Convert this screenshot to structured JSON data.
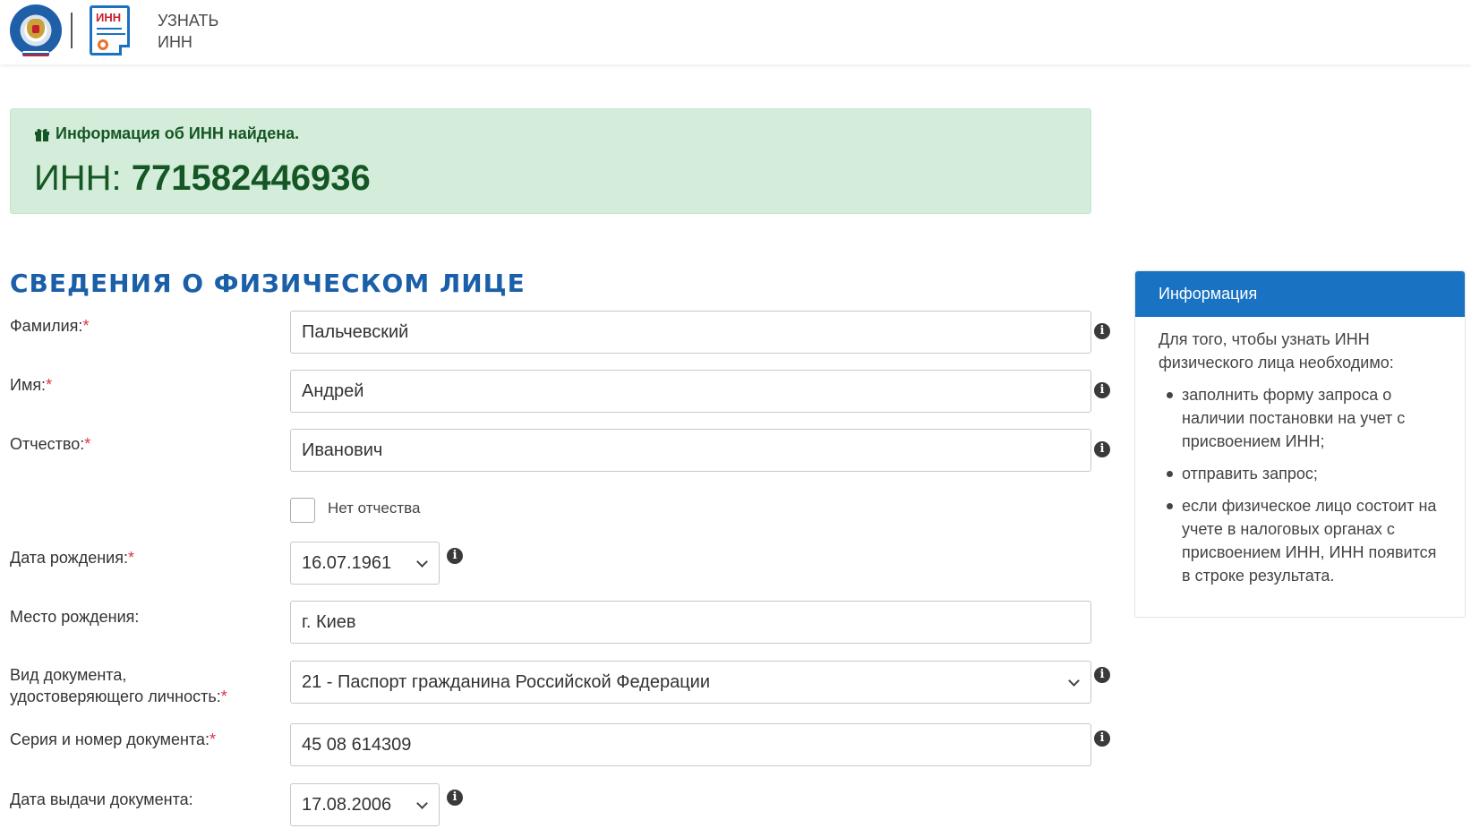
{
  "header": {
    "title_line1": "УЗНАТЬ",
    "title_line2": "ИНН",
    "doc_icon_text": "ИНН",
    "emblem_icon": "fns-emblem-icon"
  },
  "alert": {
    "message": "Информация об ИНН найдена.",
    "inn_label": "ИНН:",
    "inn_value": "771582446936",
    "color": "#d4edda"
  },
  "section": {
    "title": "СВЕДЕНИЯ О ФИЗИЧЕСКОМ ЛИЦЕ"
  },
  "form": {
    "required_mark": "*",
    "surname": {
      "label": "Фамилия:",
      "value": "Пальчевский"
    },
    "name": {
      "label": "Имя:",
      "value": "Андрей"
    },
    "patronymic": {
      "label": "Отчество:",
      "value": "Иванович"
    },
    "no_patronymic": {
      "label": "Нет отчества",
      "checked": false
    },
    "birth_date": {
      "label": "Дата рождения:",
      "value": "16.07.1961"
    },
    "birth_place": {
      "label": "Место рождения:",
      "value": "г. Киев"
    },
    "doc_type": {
      "label_line1": "Вид документа,",
      "label_line2": "удостоверяющего личность:",
      "value": "21 - Паспорт гражданина Российской Федерации"
    },
    "doc_number": {
      "label": "Серия и номер документа:",
      "value": "45 08 614309"
    },
    "doc_date": {
      "label": "Дата выдачи документа:",
      "value": "17.08.2006"
    }
  },
  "info_panel": {
    "title": "Информация",
    "intro": "Для того, чтобы узнать ИНН физического лица необходимо:",
    "items": [
      "заполнить форму запроса о наличии постановки на учет с присвоением ИНН;",
      "отправить запрос;",
      "если физическое лицо состоит на учете в налоговых органах с присвоением ИНН, ИНН появится в строке результата."
    ],
    "accent": "#1a72c2"
  }
}
